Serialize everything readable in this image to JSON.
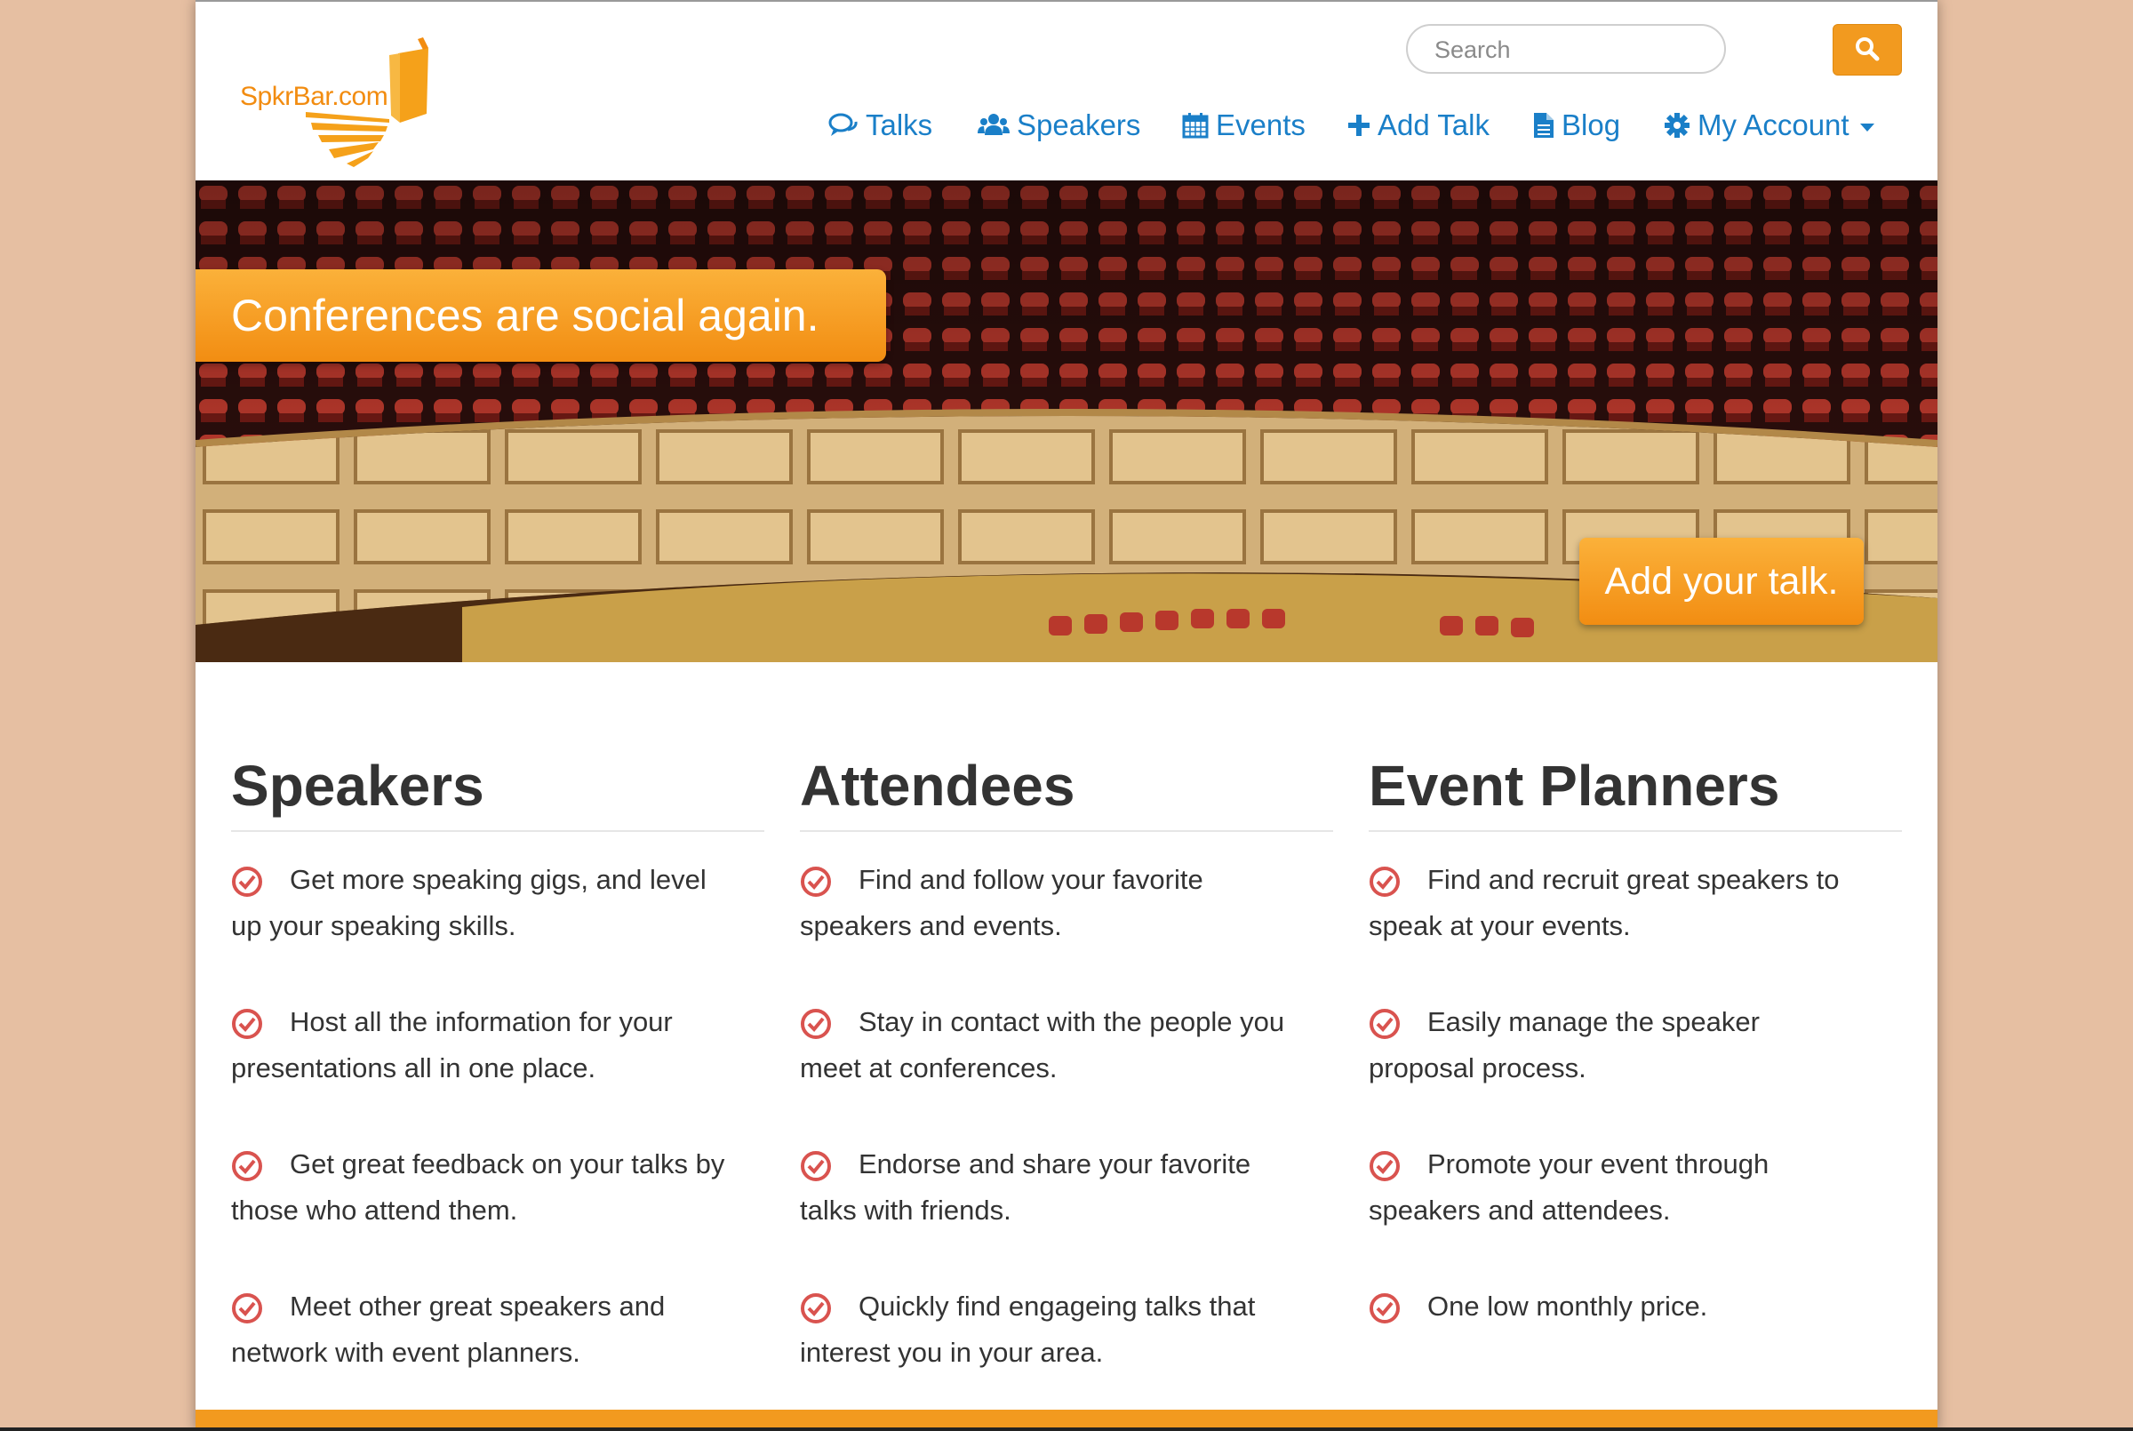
{
  "brand": {
    "logo_text": "SpkrBar.com",
    "accent": "#f29a1f",
    "link": "#1a7fc8"
  },
  "search": {
    "placeholder": "Search"
  },
  "nav": {
    "items": [
      {
        "label": "Talks",
        "icon": "comments-icon"
      },
      {
        "label": "Speakers",
        "icon": "users-icon"
      },
      {
        "label": "Events",
        "icon": "calendar-icon"
      },
      {
        "label": "Add Talk",
        "icon": "plus-icon"
      },
      {
        "label": "Blog",
        "icon": "document-icon"
      },
      {
        "label": "My Account",
        "icon": "gear-icon"
      }
    ]
  },
  "hero": {
    "tagline": "Conferences are social again.",
    "cta": "Add your talk."
  },
  "columns": [
    {
      "title": "Speakers",
      "features": [
        "Get more speaking gigs, and level up your speaking skills.",
        "Host all the information for your presentations all in one place.",
        "Get great feedback on your talks by those who attend them.",
        "Meet other great speakers and network with event planners."
      ]
    },
    {
      "title": "Attendees",
      "features": [
        "Find and follow your favorite speakers and events.",
        "Stay in contact with the people you meet at conferences.",
        "Endorse and share your favorite talks with friends.",
        "Quickly find engageing talks that interest you in your area."
      ]
    },
    {
      "title": "Event Planners",
      "features": [
        "Find and recruit great speakers to speak at your events.",
        "Easily manage the speaker proposal process.",
        "Promote your event through speakers and attendees.",
        "One low monthly price."
      ]
    }
  ]
}
